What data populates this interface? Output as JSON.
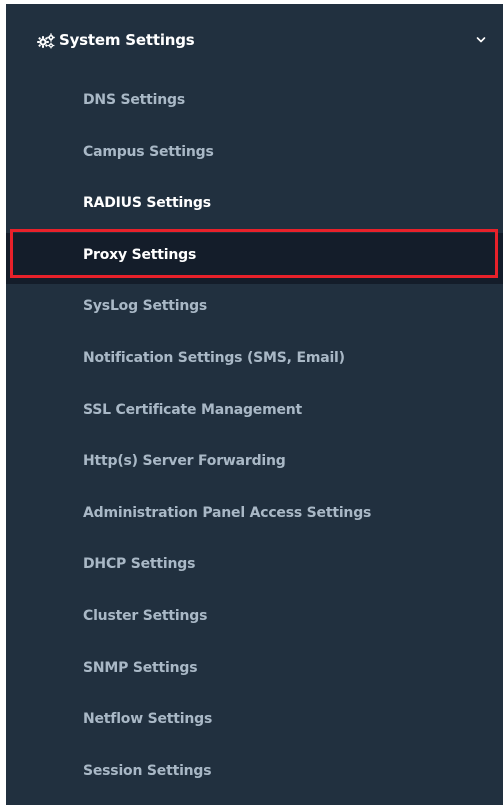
{
  "sidebar": {
    "section": {
      "title": "System Settings",
      "icon": "gears-icon",
      "toggle_icon": "chevron-down-icon"
    },
    "items": [
      {
        "label": "DNS Settings",
        "state": "normal"
      },
      {
        "label": "Campus Settings",
        "state": "normal"
      },
      {
        "label": "RADIUS Settings",
        "state": "active"
      },
      {
        "label": "Proxy Settings",
        "state": "selected"
      },
      {
        "label": "SysLog Settings",
        "state": "normal"
      },
      {
        "label": "Notification Settings (SMS, Email)",
        "state": "normal"
      },
      {
        "label": "SSL Certificate Management",
        "state": "normal"
      },
      {
        "label": "Http(s) Server Forwarding",
        "state": "normal"
      },
      {
        "label": "Administration Panel Access Settings",
        "state": "normal"
      },
      {
        "label": "DHCP Settings",
        "state": "normal"
      },
      {
        "label": "Cluster Settings",
        "state": "normal"
      },
      {
        "label": "SNMP Settings",
        "state": "normal"
      },
      {
        "label": "Netflow Settings",
        "state": "normal"
      },
      {
        "label": "Session Settings",
        "state": "normal"
      }
    ]
  },
  "colors": {
    "sidebar_bg": "#21303f",
    "item_text": "#a9b8c6",
    "active_text": "#ffffff",
    "selected_bg": "#141d2a",
    "highlight_border": "#e8212a"
  }
}
